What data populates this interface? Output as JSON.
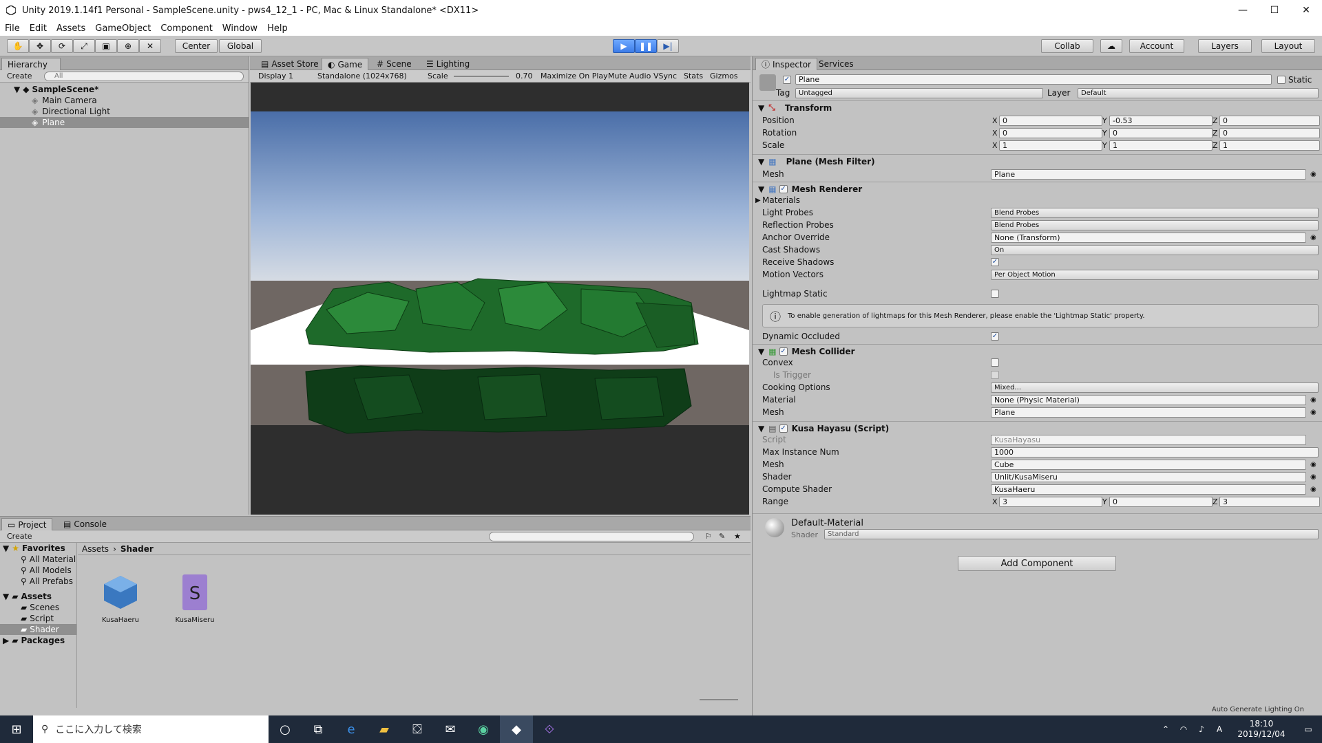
{
  "window": {
    "title": "Unity 2019.1.14f1 Personal - SampleScene.unity - pws4_12_1 - PC, Mac & Linux Standalone* <DX11>"
  },
  "menu": [
    "File",
    "Edit",
    "Assets",
    "GameObject",
    "Component",
    "Window",
    "Help"
  ],
  "toolbar": {
    "center": "Center",
    "global": "Global",
    "collab": "Collab",
    "account": "Account",
    "layers": "Layers",
    "layout": "Layout"
  },
  "hierarchy": {
    "tab": "Hierarchy",
    "create": "Create",
    "search_placeholder": "All",
    "scene": "SampleScene*",
    "items": [
      "Main Camera",
      "Directional Light",
      "Plane"
    ]
  },
  "center_tabs": [
    "Asset Store",
    "Game",
    "Scene",
    "Lighting"
  ],
  "game_bar": {
    "display": "Display 1",
    "resolution": "Standalone (1024x768)",
    "scale_label": "Scale",
    "scale_value": "0.70",
    "maximize": "Maximize On Play",
    "mute": "Mute Audio",
    "vsync": "VSync",
    "stats": "Stats",
    "gizmos": "Gizmos"
  },
  "project": {
    "tabs": [
      "Project",
      "Console"
    ],
    "create": "Create",
    "favorites": "Favorites",
    "fav_items": [
      "All Material",
      "All Models",
      "All Prefabs"
    ],
    "assets": "Assets",
    "asset_folders": [
      "Scenes",
      "Script",
      "Shader"
    ],
    "packages": "Packages",
    "breadcrumb": [
      "Assets",
      "Shader"
    ],
    "files": [
      "KusaHaeru",
      "KusaMiseru"
    ]
  },
  "inspector": {
    "tabs": [
      "Inspector",
      "Services"
    ],
    "object_name": "Plane",
    "static_label": "Static",
    "tag_label": "Tag",
    "tag_value": "Untagged",
    "layer_label": "Layer",
    "layer_value": "Default",
    "transform": {
      "title": "Transform",
      "rows": [
        {
          "label": "Position",
          "x": "0",
          "y": "-0.53",
          "z": "0"
        },
        {
          "label": "Rotation",
          "x": "0",
          "y": "0",
          "z": "0"
        },
        {
          "label": "Scale",
          "x": "1",
          "y": "1",
          "z": "1"
        }
      ]
    },
    "mesh_filter": {
      "title": "Plane (Mesh Filter)",
      "label": "Mesh",
      "value": "Plane"
    },
    "mesh_renderer": {
      "title": "Mesh Renderer",
      "materials": "Materials",
      "rows": [
        {
          "label": "Light Probes",
          "value": "Blend Probes"
        },
        {
          "label": "Reflection Probes",
          "value": "Blend Probes"
        },
        {
          "label": "Anchor Override",
          "value": "None (Transform)"
        },
        {
          "label": "Cast Shadows",
          "value": "On"
        },
        {
          "label": "Receive Shadows",
          "value": ""
        },
        {
          "label": "Motion Vectors",
          "value": "Per Object Motion"
        }
      ],
      "lightmap_static": "Lightmap Static",
      "info": "To enable generation of lightmaps for this Mesh Renderer, please enable the 'Lightmap Static' property.",
      "dynamic_occluded": "Dynamic Occluded"
    },
    "mesh_collider": {
      "title": "Mesh Collider",
      "convex": "Convex",
      "is_trigger": "Is Trigger",
      "cooking_label": "Cooking Options",
      "cooking_value": "Mixed...",
      "material_label": "Material",
      "material_value": "None (Physic Material)",
      "mesh_label": "Mesh",
      "mesh_value": "Plane"
    },
    "script": {
      "title": "Kusa Hayasu (Script)",
      "rows": [
        {
          "label": "Script",
          "value": "KusaHayasu"
        },
        {
          "label": "Max Instance Num",
          "value": "1000"
        },
        {
          "label": "Mesh",
          "value": "Cube"
        },
        {
          "label": "Shader",
          "value": "Unlit/KusaMiseru"
        },
        {
          "label": "Compute Shader",
          "value": "KusaHaeru"
        }
      ],
      "range_label": "Range",
      "range": {
        "x": "3",
        "y": "0",
        "z": "3"
      }
    },
    "material": {
      "name": "Default-Material",
      "shader_label": "Shader",
      "shader_value": "Standard"
    },
    "add_component": "Add Component",
    "status": "Auto Generate Lighting On"
  },
  "taskbar": {
    "search": "ここに入力して検索",
    "time": "18:10",
    "date": "2019/12/04",
    "ime": "A"
  }
}
